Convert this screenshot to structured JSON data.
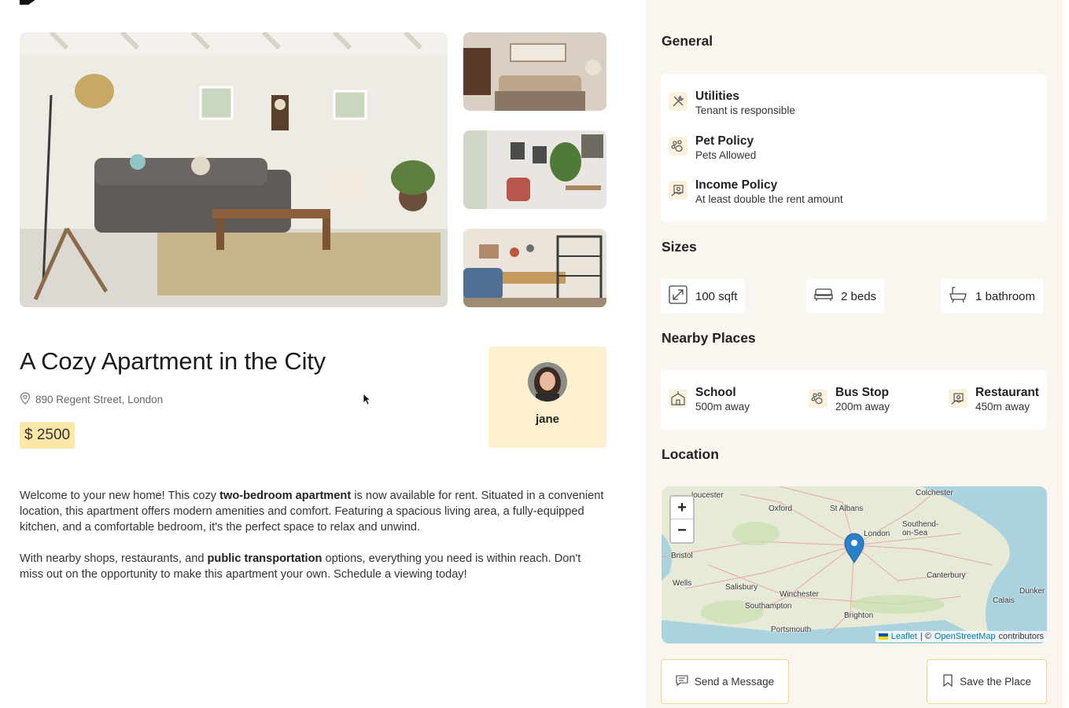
{
  "listing": {
    "title": "A Cozy Apartment in the City",
    "address": "890 Regent Street, London",
    "price": "$ 2500",
    "host": {
      "name": "jane"
    },
    "description": {
      "p1_a": "Welcome to your new home! This cozy ",
      "p1_b": "two-bedroom apartment",
      "p1_c": " is now available for rent. Situated in a convenient location, this apartment offers modern amenities and comfort. Featuring a spacious living area, a fully-equipped kitchen, and a comfortable bedroom, it's the perfect space to relax and unwind.",
      "p2_a": "With nearby shops, restaurants, and ",
      "p2_b": "public transportation",
      "p2_c": " options, everything you need is within reach. Don't miss out on the opportunity to make this apartment your own. Schedule a viewing today!"
    }
  },
  "panel": {
    "general": {
      "title": "General",
      "items": [
        {
          "title": "Utilities",
          "subtitle": "Tenant is responsible",
          "icon": "tools-icon"
        },
        {
          "title": "Pet Policy",
          "subtitle": "Pets Allowed",
          "icon": "paw-icon"
        },
        {
          "title": "Income Policy",
          "subtitle": "At least double the rent amount",
          "icon": "money-icon"
        }
      ]
    },
    "sizes": {
      "title": "Sizes",
      "items": [
        {
          "label": "100 sqft",
          "icon": "expand-icon"
        },
        {
          "label": "2 beds",
          "icon": "bed-icon"
        },
        {
          "label": "1 bathroom",
          "icon": "bath-icon"
        }
      ]
    },
    "nearby": {
      "title": "Nearby Places",
      "items": [
        {
          "title": "School",
          "distance": "500m away",
          "icon": "school-icon"
        },
        {
          "title": "Bus Stop",
          "distance": "200m away",
          "icon": "paw-icon"
        },
        {
          "title": "Restaurant",
          "distance": "450m away",
          "icon": "restaurant-icon"
        }
      ]
    },
    "location": {
      "title": "Location",
      "zoom_in": "+",
      "zoom_out": "−",
      "places": [
        "loucester",
        "Oxford",
        "St Albans",
        "Colchester",
        "London",
        "Southend-on-Sea",
        "Bristol",
        "Wells",
        "Salisbury",
        "Winchester",
        "Canterbury",
        "Dunker",
        "Calais",
        "Southampton",
        "Brighton",
        "Portsmouth"
      ],
      "attribution": {
        "leaflet": "Leaflet",
        "sep": "| ©",
        "osm": "OpenStreetMap",
        "suffix": "contributors"
      }
    },
    "actions": {
      "send_message": "Send a Message",
      "save_place": "Save the Place"
    }
  },
  "colors": {
    "accent": "#f3c13a",
    "price_bg": "#fbe8a6",
    "host_bg": "#fdf1cf",
    "panel_bg": "#fbf5f0",
    "map_marker": "#2a81cb"
  }
}
